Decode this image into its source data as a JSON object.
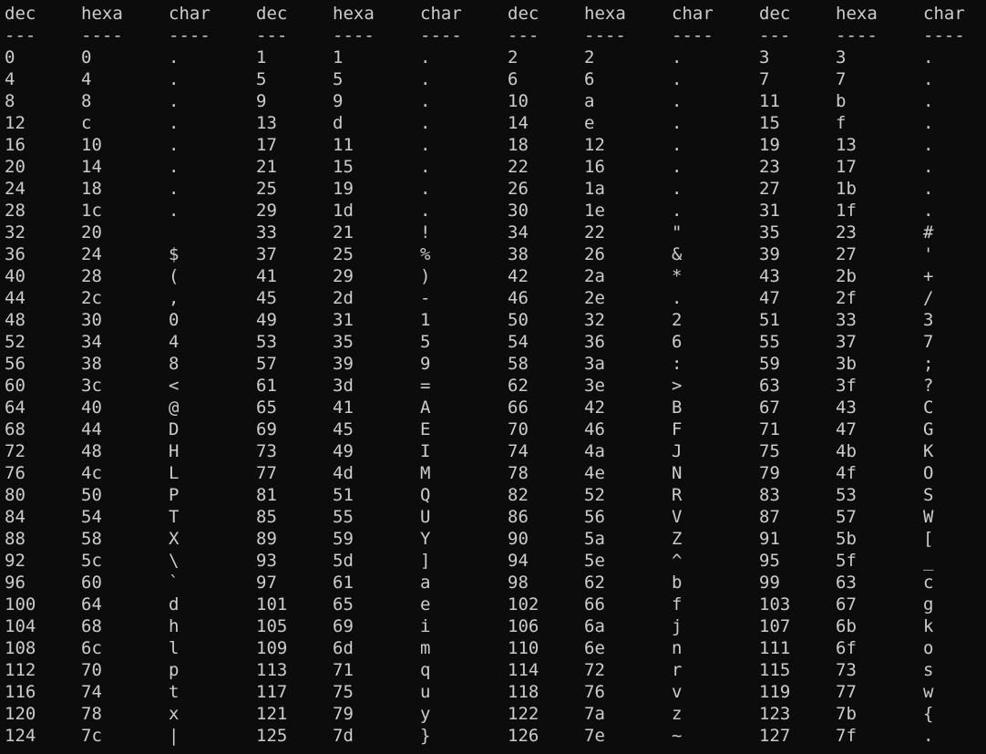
{
  "terminal": {
    "header": [
      "dec",
      "hexa",
      "char",
      "dec",
      "hexa",
      "char",
      "dec",
      "hexa",
      "char",
      "dec",
      "hexa",
      "char"
    ],
    "separator": [
      "---",
      "----",
      "----",
      "---",
      "----",
      "----",
      "---",
      "----",
      "----",
      "---",
      "----",
      "----"
    ],
    "rows": [
      [
        "0",
        "0",
        ".",
        "1",
        "1",
        ".",
        "2",
        "2",
        ".",
        "3",
        "3",
        "."
      ],
      [
        "4",
        "4",
        ".",
        "5",
        "5",
        ".",
        "6",
        "6",
        ".",
        "7",
        "7",
        "."
      ],
      [
        "8",
        "8",
        ".",
        "9",
        "9",
        ".",
        "10",
        "a",
        ".",
        "11",
        "b",
        "."
      ],
      [
        "12",
        "c",
        ".",
        "13",
        "d",
        ".",
        "14",
        "e",
        ".",
        "15",
        "f",
        "."
      ],
      [
        "16",
        "10",
        ".",
        "17",
        "11",
        ".",
        "18",
        "12",
        ".",
        "19",
        "13",
        "."
      ],
      [
        "20",
        "14",
        ".",
        "21",
        "15",
        ".",
        "22",
        "16",
        ".",
        "23",
        "17",
        "."
      ],
      [
        "24",
        "18",
        ".",
        "25",
        "19",
        ".",
        "26",
        "1a",
        ".",
        "27",
        "1b",
        "."
      ],
      [
        "28",
        "1c",
        ".",
        "29",
        "1d",
        ".",
        "30",
        "1e",
        ".",
        "31",
        "1f",
        "."
      ],
      [
        "32",
        "20",
        "",
        "33",
        "21",
        "!",
        "34",
        "22",
        "\"",
        "35",
        "23",
        "#"
      ],
      [
        "36",
        "24",
        "$",
        "37",
        "25",
        "%",
        "38",
        "26",
        "&",
        "39",
        "27",
        "'"
      ],
      [
        "40",
        "28",
        "(",
        "41",
        "29",
        ")",
        "42",
        "2a",
        "*",
        "43",
        "2b",
        "+"
      ],
      [
        "44",
        "2c",
        ",",
        "45",
        "2d",
        "-",
        "46",
        "2e",
        ".",
        "47",
        "2f",
        "/"
      ],
      [
        "48",
        "30",
        "0",
        "49",
        "31",
        "1",
        "50",
        "32",
        "2",
        "51",
        "33",
        "3"
      ],
      [
        "52",
        "34",
        "4",
        "53",
        "35",
        "5",
        "54",
        "36",
        "6",
        "55",
        "37",
        "7"
      ],
      [
        "56",
        "38",
        "8",
        "57",
        "39",
        "9",
        "58",
        "3a",
        ":",
        "59",
        "3b",
        ";"
      ],
      [
        "60",
        "3c",
        "<",
        "61",
        "3d",
        "=",
        "62",
        "3e",
        ">",
        "63",
        "3f",
        "?"
      ],
      [
        "64",
        "40",
        "@",
        "65",
        "41",
        "A",
        "66",
        "42",
        "B",
        "67",
        "43",
        "C"
      ],
      [
        "68",
        "44",
        "D",
        "69",
        "45",
        "E",
        "70",
        "46",
        "F",
        "71",
        "47",
        "G"
      ],
      [
        "72",
        "48",
        "H",
        "73",
        "49",
        "I",
        "74",
        "4a",
        "J",
        "75",
        "4b",
        "K"
      ],
      [
        "76",
        "4c",
        "L",
        "77",
        "4d",
        "M",
        "78",
        "4e",
        "N",
        "79",
        "4f",
        "O"
      ],
      [
        "80",
        "50",
        "P",
        "81",
        "51",
        "Q",
        "82",
        "52",
        "R",
        "83",
        "53",
        "S"
      ],
      [
        "84",
        "54",
        "T",
        "85",
        "55",
        "U",
        "86",
        "56",
        "V",
        "87",
        "57",
        "W"
      ],
      [
        "88",
        "58",
        "X",
        "89",
        "59",
        "Y",
        "90",
        "5a",
        "Z",
        "91",
        "5b",
        "["
      ],
      [
        "92",
        "5c",
        "\\",
        "93",
        "5d",
        "]",
        "94",
        "5e",
        "^",
        "95",
        "5f",
        "_"
      ],
      [
        "96",
        "60",
        "`",
        "97",
        "61",
        "a",
        "98",
        "62",
        "b",
        "99",
        "63",
        "c"
      ],
      [
        "100",
        "64",
        "d",
        "101",
        "65",
        "e",
        "102",
        "66",
        "f",
        "103",
        "67",
        "g"
      ],
      [
        "104",
        "68",
        "h",
        "105",
        "69",
        "i",
        "106",
        "6a",
        "j",
        "107",
        "6b",
        "k"
      ],
      [
        "108",
        "6c",
        "l",
        "109",
        "6d",
        "m",
        "110",
        "6e",
        "n",
        "111",
        "6f",
        "o"
      ],
      [
        "112",
        "70",
        "p",
        "113",
        "71",
        "q",
        "114",
        "72",
        "r",
        "115",
        "73",
        "s"
      ],
      [
        "116",
        "74",
        "t",
        "117",
        "75",
        "u",
        "118",
        "76",
        "v",
        "119",
        "77",
        "w"
      ],
      [
        "120",
        "78",
        "x",
        "121",
        "79",
        "y",
        "122",
        "7a",
        "z",
        "123",
        "7b",
        "{"
      ],
      [
        "124",
        "7c",
        "|",
        "125",
        "7d",
        "}",
        "126",
        "7e",
        "~",
        "127",
        "7f",
        "."
      ]
    ]
  }
}
